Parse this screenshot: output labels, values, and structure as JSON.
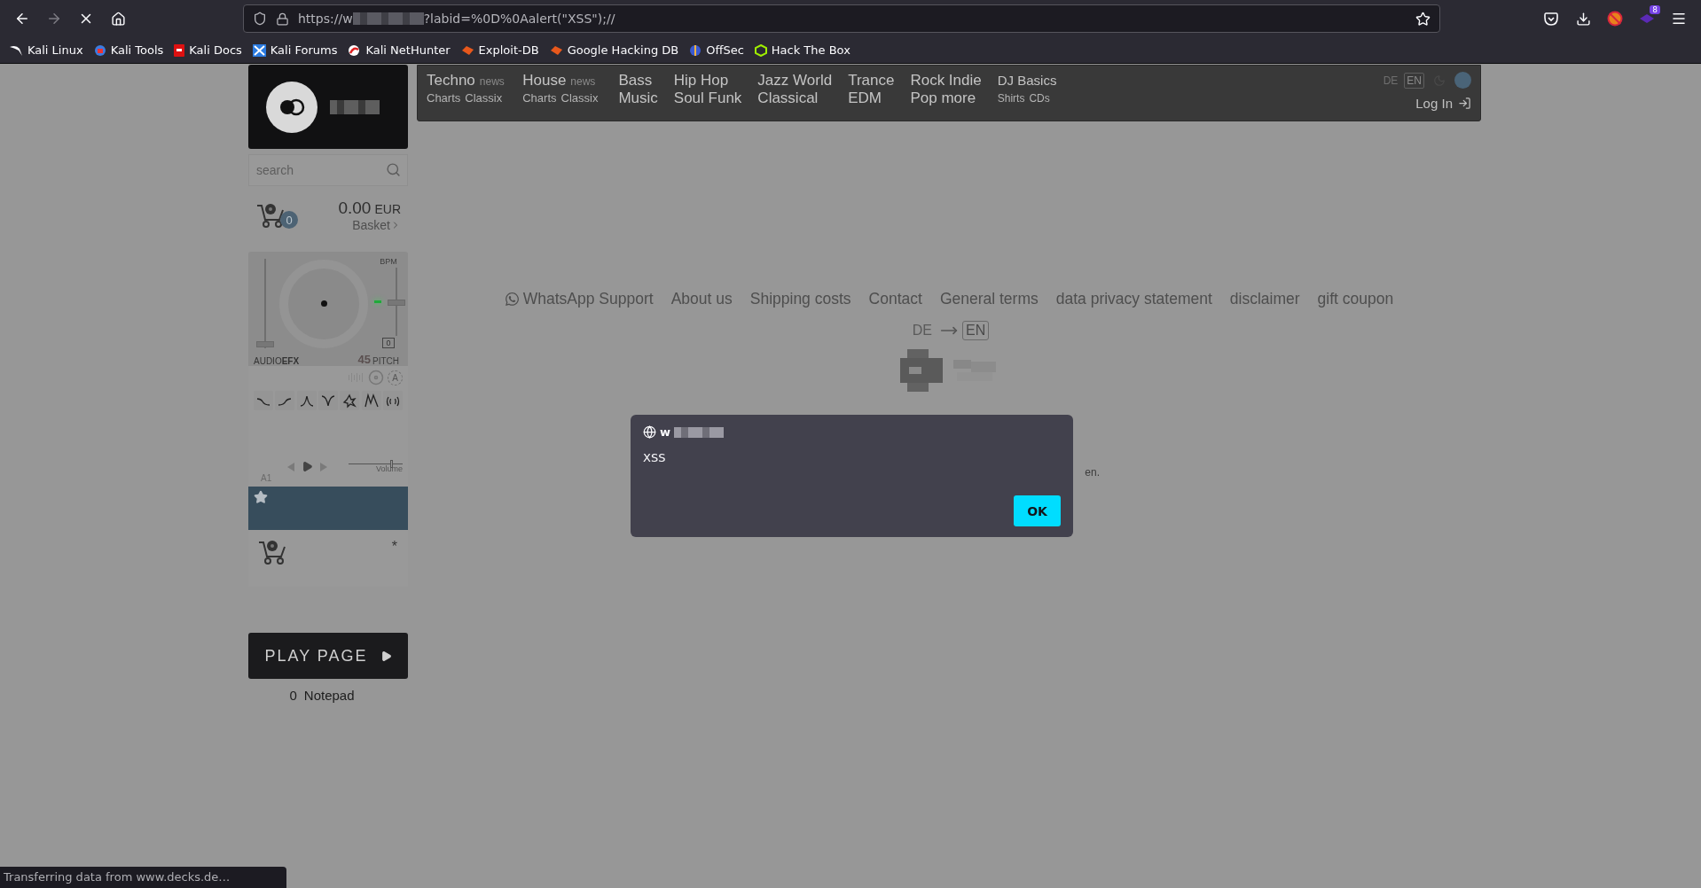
{
  "browser": {
    "loading": true,
    "url_start": "https://w",
    "url_end": "?labid=%0D%0Aalert(\"XSS\");//",
    "extension_badge": "8"
  },
  "bookmarks": [
    {
      "label": "Kali Linux"
    },
    {
      "label": "Kali Tools"
    },
    {
      "label": "Kali Docs"
    },
    {
      "label": "Kali Forums"
    },
    {
      "label": "Kali NetHunter"
    },
    {
      "label": "Exploit-DB"
    },
    {
      "label": "Google Hacking DB"
    },
    {
      "label": "OffSec"
    },
    {
      "label": "Hack The Box"
    }
  ],
  "sidebar": {
    "search": {
      "placeholder": "search"
    },
    "basket": {
      "count": "0",
      "amount": "0.00",
      "currency": "EUR",
      "label": "Basket"
    },
    "player": {
      "bpm_label": "BPM",
      "efx_label": "AUDIO**EFX**",
      "pitch_value": "0",
      "speed": "45",
      "pitch_label": "PITCH",
      "auto_label": "A",
      "volume_label": "Volume",
      "deck": "A1",
      "gain": {
        "level": 0.05
      },
      "pitch": {
        "level": 0.5
      },
      "volume": {
        "level": 0.77
      }
    },
    "rating_mark": "*",
    "play_button": "PLAY PAGE",
    "notepad": {
      "count": "0",
      "label": "Notepad"
    }
  },
  "nav": {
    "items": [
      {
        "kind": "split",
        "title": "Techno",
        "tag": "news",
        "links": [
          "Charts",
          "Classix"
        ]
      },
      {
        "kind": "split",
        "title": "House",
        "tag": "news",
        "links": [
          "Charts",
          "Classix"
        ]
      },
      {
        "kind": "double",
        "lines": [
          "Bass",
          "Music"
        ]
      },
      {
        "kind": "double",
        "lines": [
          "Hip Hop",
          "Soul Funk"
        ]
      },
      {
        "kind": "double",
        "lines": [
          "Jazz World",
          "Classical"
        ]
      },
      {
        "kind": "double",
        "lines": [
          "Trance",
          "EDM"
        ]
      },
      {
        "kind": "double",
        "lines": [
          "Rock Indie",
          "Pop more"
        ]
      },
      {
        "kind": "small",
        "title": "DJ Basics",
        "links": [
          "Shirts",
          "CDs"
        ]
      }
    ],
    "languages": [
      {
        "label": "DE",
        "selected": false
      },
      {
        "label": "EN",
        "selected": true
      }
    ],
    "login": "Log In"
  },
  "footer": {
    "links": [
      "WhatsApp Support",
      "About us",
      "Shipping costs",
      "Contact",
      "General terms",
      "data privacy statement",
      "disclaimer",
      "gift coupon"
    ],
    "languages": [
      {
        "label": "DE",
        "selected": false
      },
      {
        "label": "EN",
        "selected": true
      }
    ],
    "partial_text": "en."
  },
  "dialog": {
    "origin": "w",
    "message": "XSS",
    "button": "OK"
  },
  "status_bar": "Transferring data from www.decks.de…"
}
